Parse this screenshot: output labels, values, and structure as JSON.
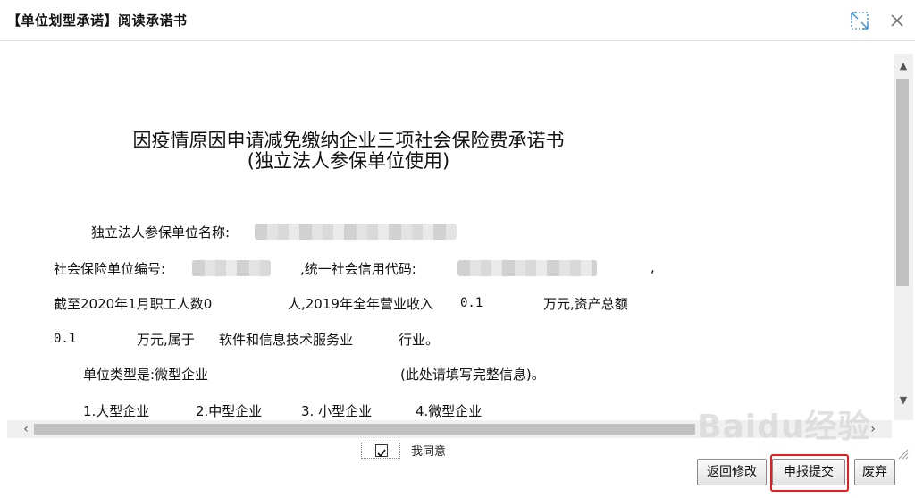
{
  "window": {
    "title": "【单位划型承诺】阅读承诺书"
  },
  "doc": {
    "title": "因疫情原因申请减免缴纳企业三项社会保险费承诺书",
    "subtitle": "(独立法人参保单位使用)",
    "unit_name_label": "独立法人参保单位名称:",
    "ss_no_label": "社会保险单位编号:",
    "credit_code_label": ",统一社会信用代码:",
    "comma": ",",
    "line3_prefix": "截至2020年1月职工人数0",
    "line3_mid": "人,2019年全年营业收入",
    "revenue_value": "0.1",
    "line3_suffix": "万元,资产总额",
    "assets_value": "0.1",
    "line4_mid": "万元,属于",
    "industry": "软件和信息技术服务业",
    "industry_suffix": "行业。",
    "unit_type_label": "单位类型是:微型企业",
    "unit_type_note": "(此处请填写完整信息)。",
    "types": [
      "1.大型企业",
      "2.中型企业",
      "3. 小型企业",
      "4.微型企业"
    ]
  },
  "agree": {
    "label": "我同意",
    "checked": true
  },
  "buttons": {
    "back": "返回修改",
    "submit": "申报提交",
    "abandon": "废弃"
  },
  "watermark": "Baidu经验",
  "colors": {
    "highlight": "#e02020",
    "scroll_thumb": "#c1c1c1"
  }
}
